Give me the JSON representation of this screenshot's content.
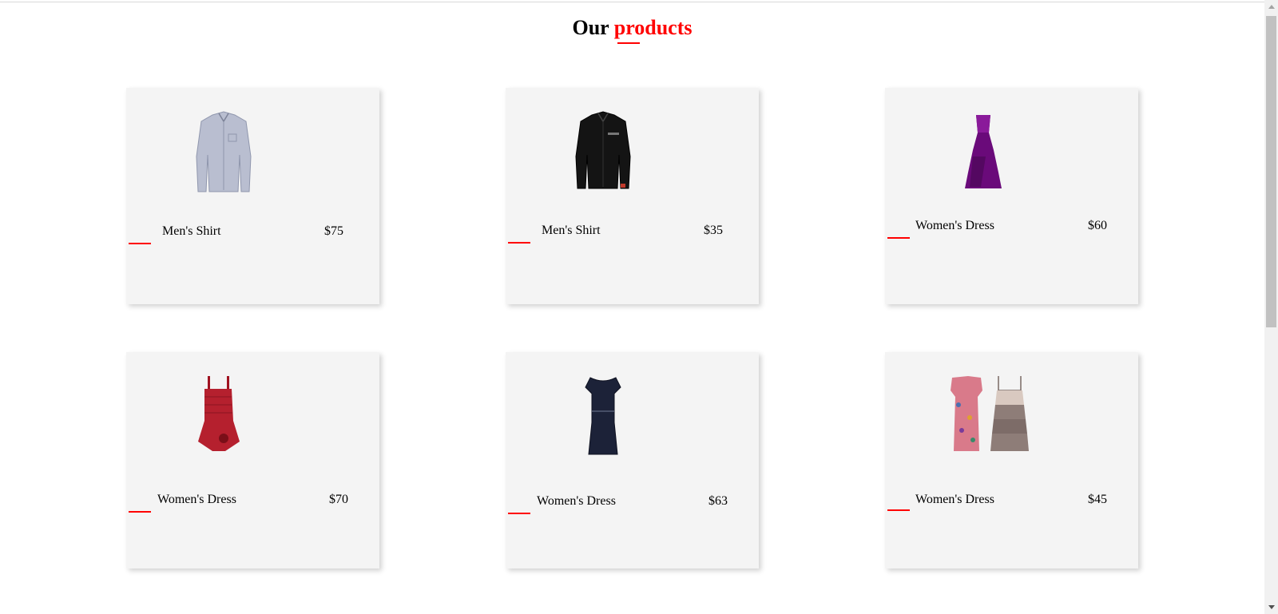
{
  "heading": {
    "prefix": "Our",
    "accent": "products",
    "accent_color": "#ff0000"
  },
  "products": [
    {
      "name": "Men's Shirt",
      "price": "$75",
      "image": "light-gray-mens-shirt-image"
    },
    {
      "name": "Men's Shirt",
      "price": "$35",
      "image": "black-mens-shirt-image"
    },
    {
      "name": "Women's Dress",
      "price": "$60",
      "image": "purple-gown-image"
    },
    {
      "name": "Women's Dress",
      "price": "$70",
      "image": "red-dress-image"
    },
    {
      "name": "Women's Dress",
      "price": "$63",
      "image": "navy-dress-image"
    },
    {
      "name": "Women's Dress",
      "price": "$45",
      "image": "floral-and-tiered-dresses-image"
    }
  ]
}
